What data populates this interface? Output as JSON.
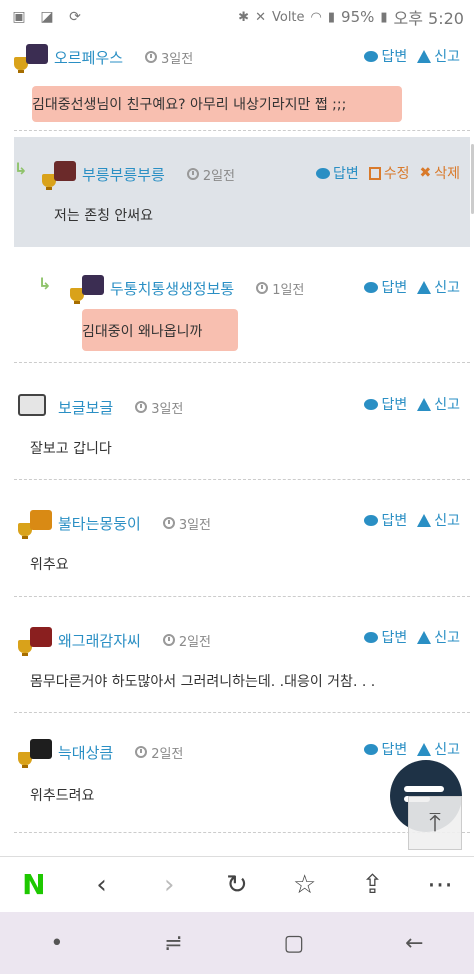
{
  "statusbar": {
    "battery": "95%",
    "time": "오후 5:20",
    "network": "Volte"
  },
  "actions": {
    "reply": "답변",
    "report": "신고",
    "edit": "수정",
    "delete": "삭제"
  },
  "comments": [
    {
      "user": "오르페우스",
      "time": "3일전",
      "text": "김대중선생님이 친구예요?  아무리 내상기라지만 쩝 ;;;"
    },
    {
      "user": "부릉부릉부릉",
      "time": "2일전",
      "text": "저는 존칭 안써요"
    },
    {
      "user": "두통치통생생정보통",
      "time": "1일전",
      "text": "김대중이 왜나옵니까"
    },
    {
      "user": "보글보글",
      "time": "3일전",
      "text": "잘보고 갑니다"
    },
    {
      "user": "불타는몽둥이",
      "time": "3일전",
      "text": "위추요"
    },
    {
      "user": "왜그래감자씨",
      "time": "2일전",
      "text": "몸무다른거야 하도많아서 그러려니하는데. .대응이 거참. . ."
    },
    {
      "user": "늑대상큼",
      "time": "2일전",
      "text": "위추드려요"
    }
  ],
  "toolbar": {
    "logo": "N"
  },
  "icons": {
    "reply": "speech-bubble-icon",
    "report": "warning-icon",
    "edit": "copy-icon",
    "delete": "x-icon",
    "time": "clock-icon",
    "back": "chevron-left-icon",
    "forward": "chevron-right-icon",
    "refresh": "refresh-icon",
    "bookmark": "star-icon",
    "share": "share-icon",
    "more": "more-icon"
  },
  "colors": {
    "username": "#2a8fc4",
    "action_blue": "#2a8fc4",
    "action_orange": "#d97a2b",
    "highlight_bg": "#dfe3e8",
    "marker": "#f6aa96",
    "naver_green": "#1ec800"
  }
}
